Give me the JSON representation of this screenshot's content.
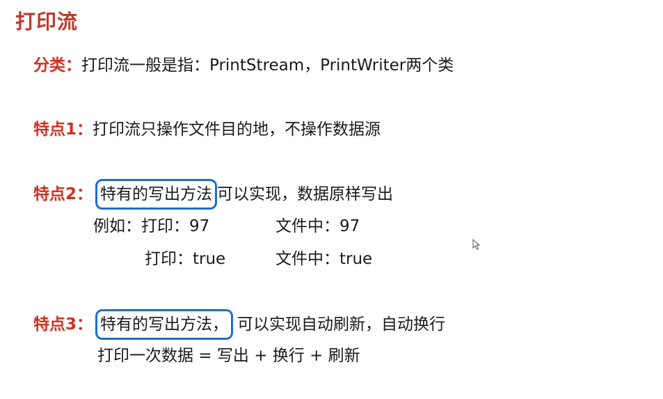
{
  "title": "打印流",
  "classification": {
    "label": "分类：",
    "text": "打印流一般是指：PrintStream，PrintWriter两个类"
  },
  "feature1": {
    "label": "特点1：",
    "text": "打印流只操作文件目的地，不操作数据源"
  },
  "feature2": {
    "label": "特点2：",
    "boxed": "特有的写出方法",
    "text": "可以实现，数据原样写出",
    "example_prefix": "例如：",
    "row1_print": "打印：97",
    "row1_file": "文件中：97",
    "row2_print": "打印：true",
    "row2_file": "文件中：true"
  },
  "feature3": {
    "label": "特点3：",
    "boxed": "特有的写出方法，",
    "text": "可以实现自动刷新，自动换行",
    "formula": "打印一次数据 = 写出 + 换行 + 刷新"
  }
}
